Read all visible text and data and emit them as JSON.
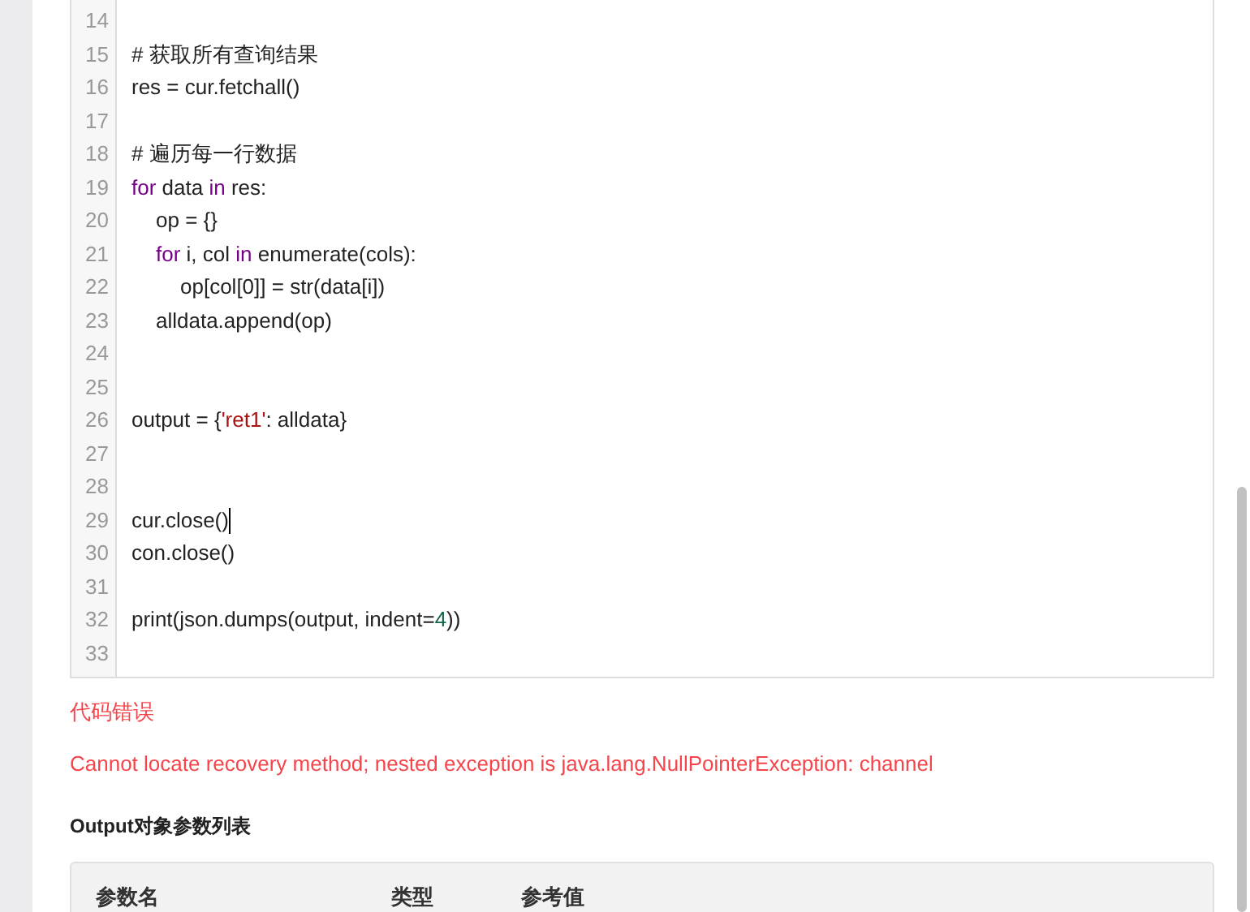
{
  "code_editor": {
    "lines": [
      {
        "number": "14"
      },
      {
        "number": "15",
        "tokens": [
          {
            "kind": "plain",
            "text": "# 获取所有查询结果"
          }
        ]
      },
      {
        "number": "16",
        "tokens": [
          {
            "kind": "plain",
            "text": "res = cur.fetchall()"
          }
        ]
      },
      {
        "number": "17"
      },
      {
        "number": "18",
        "tokens": [
          {
            "kind": "plain",
            "text": "# 遍历每一行数据"
          }
        ]
      },
      {
        "number": "19",
        "tokens": [
          {
            "kind": "keyword",
            "text": "for"
          },
          {
            "kind": "plain",
            "text": " data "
          },
          {
            "kind": "keyword",
            "text": "in"
          },
          {
            "kind": "plain",
            "text": " res:"
          }
        ],
        "children": [
          {
            "number": "20",
            "tokens": [
              {
                "kind": "plain",
                "text": "op = {}"
              }
            ]
          },
          {
            "number": "21",
            "tokens": [
              {
                "kind": "keyword",
                "text": "for"
              },
              {
                "kind": "plain",
                "text": " i, col "
              },
              {
                "kind": "keyword",
                "text": "in"
              },
              {
                "kind": "plain",
                "text": " enumerate(cols):"
              }
            ],
            "children": [
              {
                "number": "22",
                "tokens": [
                  {
                    "kind": "plain",
                    "text": "op[col[0]] = str(data[i])"
                  }
                ]
              }
            ]
          },
          {
            "number": "23",
            "tokens": [
              {
                "kind": "plain",
                "text": "alldata.append(op)"
              }
            ]
          }
        ]
      },
      {
        "number": "24"
      },
      {
        "number": "25"
      },
      {
        "number": "26",
        "tokens": [
          {
            "kind": "plain",
            "text": "output = {"
          },
          {
            "kind": "string",
            "text": "'ret1'"
          },
          {
            "kind": "plain",
            "text": ": alldata}"
          }
        ]
      },
      {
        "number": "27"
      },
      {
        "number": "28"
      },
      {
        "number": "29",
        "cursor": true,
        "tokens": [
          {
            "kind": "plain",
            "text": "cur.close()"
          }
        ]
      },
      {
        "number": "30",
        "tokens": [
          {
            "kind": "plain",
            "text": "con.close()"
          }
        ]
      },
      {
        "number": "31"
      },
      {
        "number": "32",
        "tokens": [
          {
            "kind": "plain",
            "text": "print(json.dumps(output, indent="
          },
          {
            "kind": "number",
            "text": "4"
          },
          {
            "kind": "plain",
            "text": "))"
          }
        ]
      },
      {
        "number": "33"
      }
    ]
  },
  "error": {
    "title": "代码错误",
    "message": "Cannot locate recovery method; nested exception is java.lang.NullPointerException: channel"
  },
  "output_section": {
    "heading": "Output对象参数列表",
    "table": {
      "columns": [
        "参数名",
        "类型",
        "参考值"
      ]
    }
  }
}
